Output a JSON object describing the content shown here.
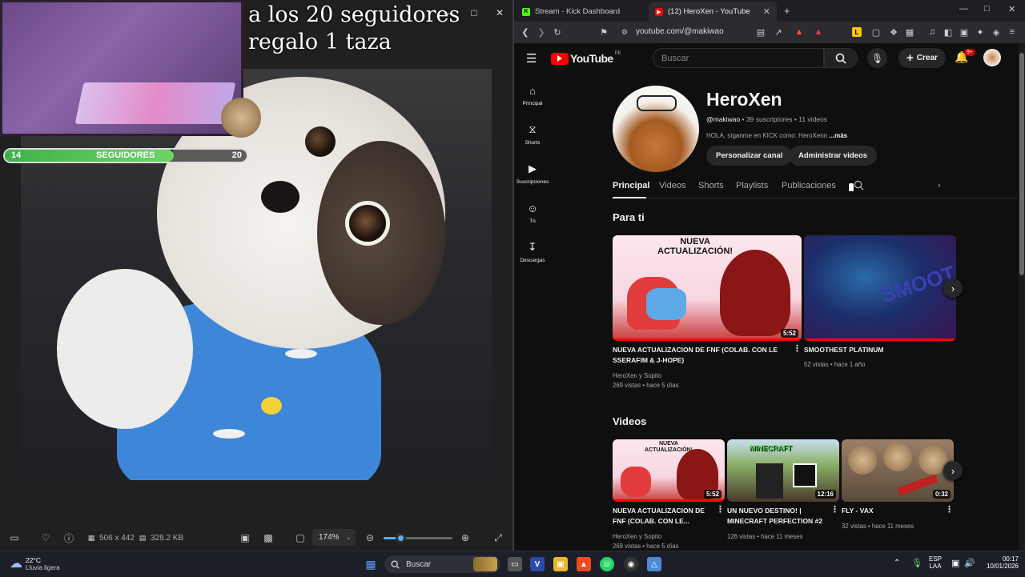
{
  "viewer": {
    "overlay_title_line1": "a los 20 seguidores",
    "overlay_title_line2": "regalo 1 taza",
    "goal": {
      "current": "14",
      "label": "SEGUIDORES",
      "target": "20",
      "progress": 0.7
    },
    "status": {
      "dimensions": "506 x 442",
      "filesize": "328.2 KB",
      "zoom": "174%",
      "zoom_level": 0.24
    }
  },
  "browser": {
    "tabs": [
      {
        "title": "Stream - Kick Dashboard",
        "favicon": "kick-icon"
      },
      {
        "title": "(12) HeroXen - YouTube",
        "favicon": "youtube-icon"
      }
    ],
    "url": "youtube.com/@makiwao"
  },
  "youtube": {
    "region": "PE",
    "search_placeholder": "Buscar",
    "create_label": "Crear",
    "notifications_badge": "9+",
    "guide": [
      {
        "label": "Principal",
        "icon": "home-icon"
      },
      {
        "label": "Shorts",
        "icon": "shorts-icon"
      },
      {
        "label": "Suscripciones",
        "icon": "subscriptions-icon"
      },
      {
        "label": "Tú",
        "icon": "you-icon"
      },
      {
        "label": "Descargas",
        "icon": "downloads-icon"
      }
    ],
    "channel": {
      "name": "HeroXen",
      "handle": "@makiwao",
      "subscribers": "39 suscriptores",
      "videos_count": "11 videos",
      "description": "HOLA, síganme en KICK como: HeroXenn",
      "more": "...más",
      "btn_customize": "Personalizar canal",
      "btn_manage": "Administrar videos"
    },
    "channel_tabs": [
      "Principal",
      "Videos",
      "Shorts",
      "Playlists",
      "Publicaciones"
    ],
    "for_you": {
      "heading": "Para ti",
      "items": [
        {
          "title_l1": "NUEVA ACTUALIZACION DE FNF (COLAB. CON LE",
          "title_l2": "SSERAFIM & J-HOPE)",
          "author": "HeroXen y Sopito",
          "stats": "269 vistas • hace 5 días",
          "duration": "5:52",
          "thumb_text_1": "NUEVA",
          "thumb_text_2": "ACTUALIZACIÓN!"
        },
        {
          "title_l1": "SMOOTHEST PLATINUM",
          "title_l2": "",
          "author": "",
          "stats": "52 vistas • hace 1 año",
          "duration": "",
          "thumb_text_1": "SMOOT",
          "thumb_text_2": ""
        }
      ]
    },
    "videos": {
      "heading": "Videos",
      "items": [
        {
          "title_l1": "NUEVA ACTUALIZACION DE",
          "title_l2": "FNF (COLAB. CON LE...",
          "author": "HeroXen y Sopito",
          "stats": "269 vistas • hace 5 días",
          "duration": "5:52",
          "thumb_text": "NUEVA ACTUALIZACIÓN!"
        },
        {
          "title_l1": "UN NUEVO DESTINO! |",
          "title_l2": "MINECRAFT PERFECTION #2",
          "author": "",
          "stats": "126 vistas • hace 11 meses",
          "duration": "12:16",
          "thumb_text": "MINECRAFT"
        },
        {
          "title_l1": "FLY - VAX",
          "title_l2": "",
          "author": "",
          "stats": "32 vistas • hace 11 meses",
          "duration": "0:32",
          "thumb_text": ""
        }
      ]
    }
  },
  "taskbar": {
    "temperature": "22°C",
    "weather": "Lluvia ligera",
    "search_label": "Buscar",
    "lang": "ESP",
    "lang_sub": "LAA",
    "time": "00:17",
    "date": "10/01/2026"
  },
  "colors": {
    "youtube_red": "#ff0000",
    "goal_green": "#4cc254",
    "zoom_accent": "#5ab0f0"
  }
}
